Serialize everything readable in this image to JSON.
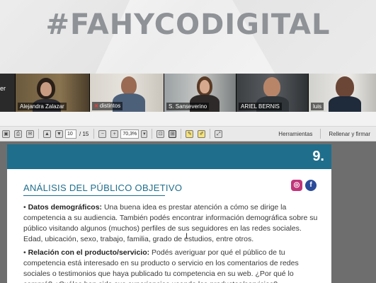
{
  "banner": {
    "title": "#FAHYCODIGITAL"
  },
  "video": {
    "partial_name": "er",
    "participants": [
      {
        "name": "Alejandra Zalazar",
        "muted": false
      },
      {
        "name": "distintos",
        "muted": true
      },
      {
        "name": "S. Sanseverino",
        "muted": false
      },
      {
        "name": "ARIEL BERNIS",
        "muted": false
      },
      {
        "name": "luis",
        "muted": false
      }
    ]
  },
  "toolbar": {
    "page_current": "10",
    "page_total": "/ 15",
    "zoom": "70,3%",
    "tools_label": "Herramientas",
    "fill_sign_label": "Rellenar y firmar"
  },
  "document": {
    "page_number": "9.",
    "section_title": "ANÁLISIS DEL PÚBLICO OBJETIVO",
    "p1_bold": "Datos demográficos:",
    "p1_text": " Una buena idea es prestar atención a cómo se dirige la competencia a su audiencia. También podés encontrar información demográfica sobre su público visitando algunos (muchos) perfiles de sus seguidores en las redes sociales. Edad, ubicación, sexo, trabajo, familia, grado de estudios, entre otros.",
    "p2_bold": "Relación con el producto/servicio:",
    "p2_text": " Podés averiguar por qué el público de tu competencia está interesado en su producto o servicio en los comentarios de redes sociales o testimonios que haya publicado tu competencia en su web. ¿Por qué lo compró? ¿Cuáles han sido sus experiencias usando los productos/servicios?"
  },
  "colors": {
    "doc_accent": "#1f6e8c",
    "banner_text": "#8f9296"
  }
}
